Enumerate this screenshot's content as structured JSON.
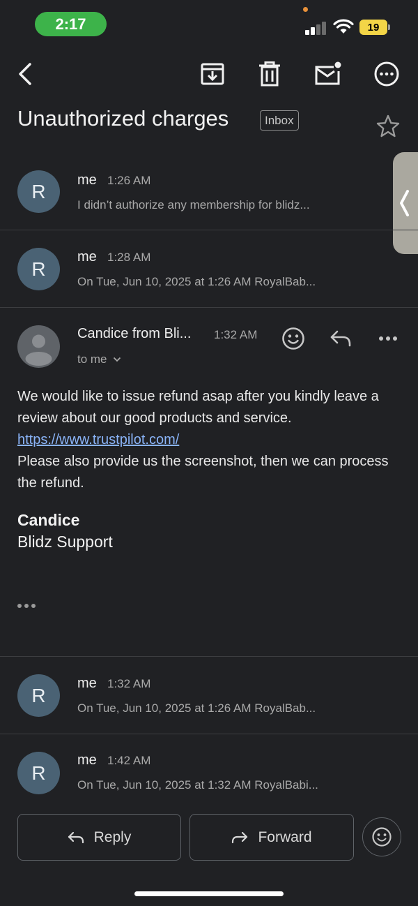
{
  "status_bar": {
    "time": "2:17",
    "battery": "19"
  },
  "toolbar": {
    "icons": [
      "back-arrow-icon",
      "archive-icon",
      "trash-icon",
      "mark-unread-icon",
      "more-options-icon"
    ]
  },
  "email": {
    "subject": "Unauthorized charges",
    "label": "Inbox"
  },
  "thread": {
    "collapsed_before": [
      {
        "avatar_letter": "R",
        "sender": "me",
        "time": "1:26 AM",
        "snippet": "I didn’t authorize any membership for blidz..."
      },
      {
        "avatar_letter": "R",
        "sender": "me",
        "time": "1:28 AM",
        "snippet": "On Tue, Jun 10, 2025 at 1:26 AM RoyalBab..."
      }
    ],
    "expanded": {
      "sender": "Candice from Bli...",
      "time": "1:32 AM",
      "recipient": "to me",
      "body_line1": "We would like to issue refund asap after you kindly leave a review about our good products and service.",
      "link": "https://www.trustpilot.com/",
      "body_line2": "Please also provide us the screenshot, then we can process the refund.",
      "signature_name": "Candice",
      "signature_org": "Blidz Support"
    },
    "collapsed_after": [
      {
        "avatar_letter": "R",
        "sender": "me",
        "time": "1:32 AM",
        "snippet": "On Tue, Jun 10, 2025 at 1:26 AM RoyalBab..."
      },
      {
        "avatar_letter": "R",
        "sender": "me",
        "time": "1:42 AM",
        "snippet": "On Tue, Jun 10, 2025 at 1:32 AM RoyalBabi..."
      }
    ]
  },
  "footer": {
    "reply_label": "Reply",
    "forward_label": "Forward"
  },
  "colors": {
    "background": "#202124",
    "avatar": "#4a6274",
    "link": "#8ab4f8",
    "time_pill": "#3db34a",
    "battery": "#f3d547"
  }
}
